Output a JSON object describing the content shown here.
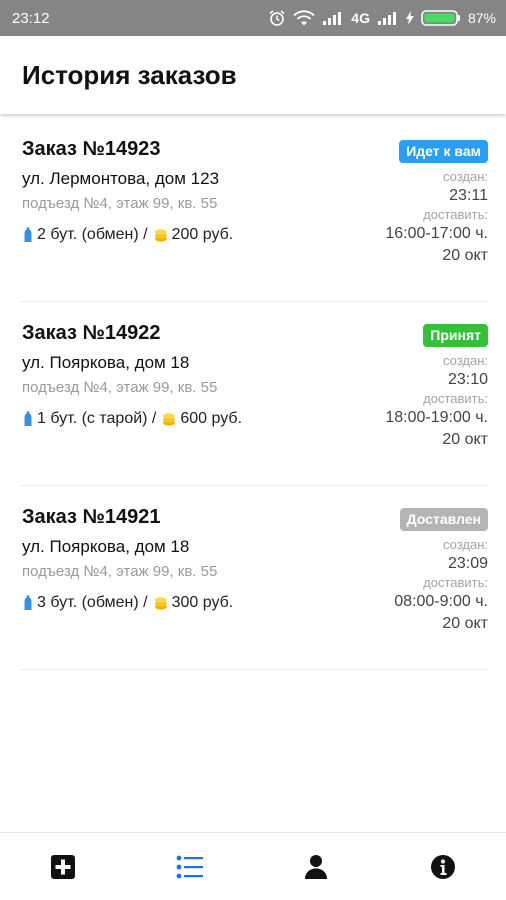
{
  "status_bar": {
    "time": "23:12",
    "network": "4G",
    "battery": "87%"
  },
  "header": {
    "title": "История заказов"
  },
  "orders": [
    {
      "title": "Заказ №14923",
      "street": "ул. Лермонтова, дом 123",
      "entrance": "подъезд №4, этаж 99, кв. 55",
      "bottles": "2 бут. (обмен) /",
      "price": "200 руб.",
      "status": "Идет к вам",
      "status_color": "#2a9df4",
      "created_label": "создан:",
      "created_time": "23:11",
      "deliver_label": "доставить:",
      "deliver_window": "16:00-17:00 ч.",
      "deliver_date": "20 окт"
    },
    {
      "title": "Заказ №14922",
      "street": "ул. Пояркова, дом 18",
      "entrance": "подъезд №4, этаж 99, кв. 55",
      "bottles": "1 бут. (с тарой) /",
      "price": "600 руб.",
      "status": "Принят",
      "status_color": "#35c03a",
      "created_label": "создан:",
      "created_time": "23:10",
      "deliver_label": "доставить:",
      "deliver_window": "18:00-19:00 ч.",
      "deliver_date": "20 окт"
    },
    {
      "title": "Заказ №14921",
      "street": "ул. Пояркова, дом 18",
      "entrance": "подъезд №4, этаж 99, кв. 55",
      "bottles": "3 бут. (обмен) /",
      "price": "300 руб.",
      "status": "Доставлен",
      "status_color": "#b4b4b4",
      "created_label": "создан:",
      "created_time": "23:09",
      "deliver_label": "доставить:",
      "deliver_window": "08:00-9:00 ч.",
      "deliver_date": "20 окт"
    }
  ],
  "bottom_nav": [
    {
      "icon": "plus-square-icon",
      "active": false
    },
    {
      "icon": "list-icon",
      "active": true
    },
    {
      "icon": "user-icon",
      "active": false
    },
    {
      "icon": "info-icon",
      "active": false
    }
  ],
  "colors": {
    "active_nav": "#1a73e8",
    "inactive_nav": "#111111",
    "status_bar": "#858585",
    "bottle_icon": "#3b8fe0",
    "coin_icon": "#f2b400"
  }
}
